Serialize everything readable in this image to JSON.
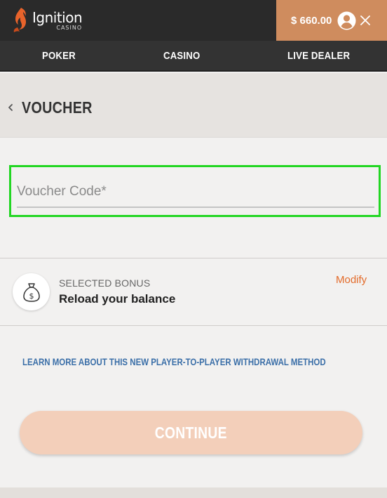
{
  "brand": {
    "name": "Ignition",
    "subname": "CASINO",
    "logo_icon": "flame-logo-icon"
  },
  "account": {
    "balance": "$ 660.00",
    "icons": [
      "account-icon",
      "close-icon"
    ]
  },
  "nav": {
    "items": [
      {
        "label": "POKER"
      },
      {
        "label": "CASINO"
      },
      {
        "label": "LIVE DEALER"
      }
    ]
  },
  "page": {
    "title": "VOUCHER",
    "back_icon": "chevron-left-icon"
  },
  "voucher": {
    "placeholder": "Voucher Code*",
    "value": ""
  },
  "bonus": {
    "label": "SELECTED BONUS",
    "name": "Reload your balance",
    "modify_label": "Modify",
    "icon": "money-bag-icon"
  },
  "learn_more": {
    "label": "LEARN MORE ABOUT THIS NEW PLAYER-TO-PLAYER WITHDRAWAL METHOD"
  },
  "continue": {
    "label": "CONTINUE"
  },
  "colors": {
    "topbar": "#2a2a2a",
    "balance_bg": "#cf8c5e",
    "accent_orange": "#e36b2a",
    "link_blue": "#3b6fa8",
    "button_disabled": "#f3cfba",
    "highlight_green": "#22d622"
  }
}
